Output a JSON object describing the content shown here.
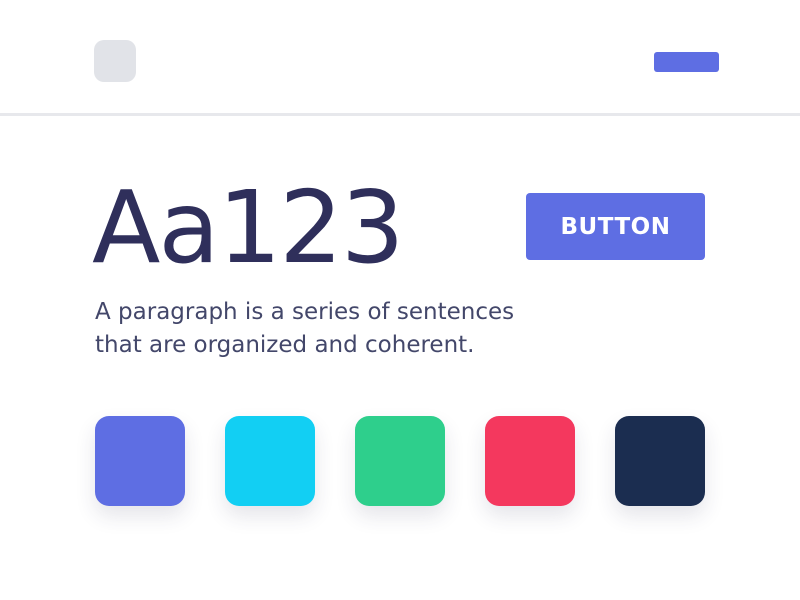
{
  "hero": {
    "display_text": "Aa123",
    "paragraph": "A paragraph is a series of sentences that are organized and coherent.",
    "button_label": "BUTTON"
  },
  "colors": {
    "accent": "#5E6EE3",
    "palette": [
      "#5E6EE3",
      "#12CFF3",
      "#2ECF8C",
      "#F4385E",
      "#1B2D50"
    ]
  }
}
